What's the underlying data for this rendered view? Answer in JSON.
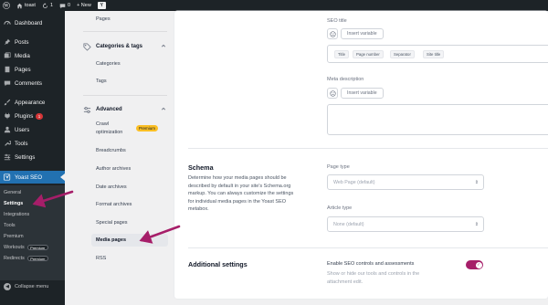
{
  "adminbar": {
    "site_name": "toast",
    "updates_count": "1",
    "comments_count": "0",
    "new_label": "+ New",
    "yoast_letter": "Y"
  },
  "admin_menu": {
    "items": [
      {
        "label": "Dashboard",
        "icon": "dashboard-icon"
      },
      {
        "label": "Posts",
        "icon": "pin-icon"
      },
      {
        "label": "Media",
        "icon": "media-icon"
      },
      {
        "label": "Pages",
        "icon": "page-icon"
      },
      {
        "label": "Comments",
        "icon": "comment-icon"
      },
      {
        "label": "Appearance",
        "icon": "brush-icon"
      },
      {
        "label": "Plugins",
        "icon": "plug-icon",
        "badge": "1"
      },
      {
        "label": "Users",
        "icon": "user-icon"
      },
      {
        "label": "Tools",
        "icon": "wrench-icon"
      },
      {
        "label": "Settings",
        "icon": "settings-icon"
      },
      {
        "label": "Yoast SEO",
        "icon": "yoast-icon"
      }
    ],
    "submenu": [
      {
        "label": "General"
      },
      {
        "label": "Settings"
      },
      {
        "label": "Integrations"
      },
      {
        "label": "Tools"
      },
      {
        "label": "Premium"
      },
      {
        "label": "Workouts",
        "badge": "Premium"
      },
      {
        "label": "Redirects",
        "badge": "Premium"
      }
    ],
    "collapse_label": "Collapse menu"
  },
  "yoast_nav": {
    "pages_item": "Pages",
    "categories_tags_heading": "Categories & tags",
    "categories_item": "Categories",
    "tags_item": "Tags",
    "advanced_heading": "Advanced",
    "crawl_line1": "Crawl",
    "crawl_line2": "optimization",
    "premium_badge": "Premium",
    "breadcrumbs_item": "Breadcrumbs",
    "author_archives_item": "Author archives",
    "date_archives_item": "Date archives",
    "format_archives_item": "Format archives",
    "special_pages_item": "Special pages",
    "media_pages_item": "Media pages",
    "rss_item": "RSS"
  },
  "main": {
    "seo_title_label": "SEO title",
    "insert_variable": "Insert variable",
    "chips": [
      "Title",
      "Page number",
      "Separator",
      "Site title"
    ],
    "meta_description_label": "Meta description",
    "schema": {
      "title": "Schema",
      "description": "Determine how your media pages should be described by default in your site's Schema.org markup. You can always customize the settings for individual media pages in the Yoast SEO metabox.",
      "page_type_label": "Page type",
      "page_type_value": "Web Page (default)",
      "article_type_label": "Article type",
      "article_type_value": "None (default)"
    },
    "additional": {
      "title": "Additional settings",
      "toggle_label": "Enable SEO controls and assessments",
      "toggle_desc": "Show or hide our tools and controls in the attachment edit.",
      "toggle_on": true
    }
  },
  "colors": {
    "adminbar_bg": "#1d2327",
    "wp_accent": "#2271b1",
    "yoast_toggle": "#a61e69",
    "arrow": "#a61e69"
  }
}
